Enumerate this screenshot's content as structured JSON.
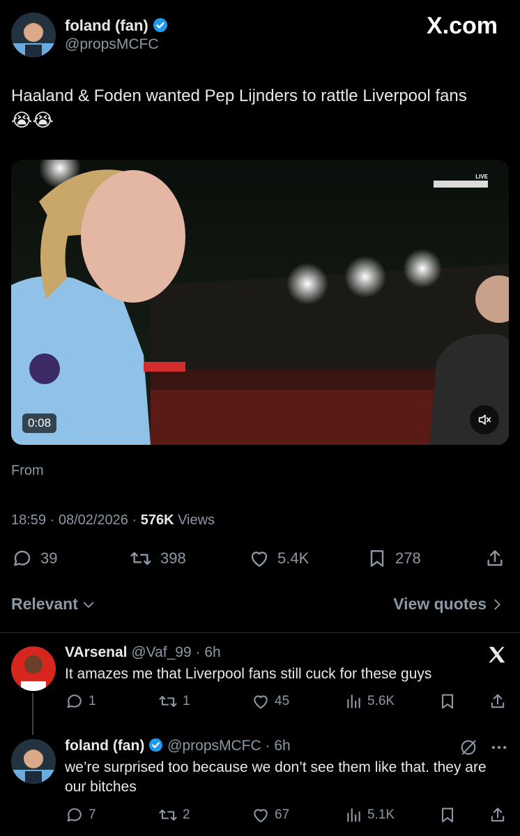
{
  "main_tweet": {
    "display_name": "foland (fan)",
    "handle": "@propsMCFC",
    "brand": "X.com",
    "text": "Haaland & Foden wanted Pep Lijnders to rattle Liverpool fans",
    "emojis": "😭😭",
    "video": {
      "duration": "0:08",
      "broadcaster_badge": "LIVE",
      "mute_icon": "speaker-muted-icon"
    },
    "from_label": "From",
    "timestamp": "18:59 · 08/02/2026 · ",
    "views_count": "576K",
    "views_label": " Views",
    "stats": {
      "replies": "39",
      "reposts": "398",
      "likes": "5.4K",
      "bookmarks": "278"
    }
  },
  "filter": {
    "relevant_label": "Relevant",
    "view_quotes_label": "View quotes"
  },
  "replies": [
    {
      "display_name": "VArsenal",
      "handle": "@Vaf_99",
      "time": " · 6h",
      "text": "It amazes me that Liverpool fans still cuck for these guys",
      "stats": {
        "replies": "1",
        "reposts": "1",
        "likes": "45",
        "views": "5.6K"
      }
    },
    {
      "display_name": "foland (fan)",
      "handle": "@propsMCFC",
      "time": " · 6h",
      "text": "we’re surprised too because we don’t see them like that. they are our bitches",
      "stats": {
        "replies": "7",
        "reposts": "2",
        "likes": "67",
        "views": "5.1K"
      }
    }
  ],
  "colors": {
    "background": "#000000",
    "text": "#e7e9ea",
    "muted": "#8b98a5",
    "verified": "#1d9bf0",
    "arsenal_red": "#d7261e",
    "city_blue": "#6cabdd"
  }
}
